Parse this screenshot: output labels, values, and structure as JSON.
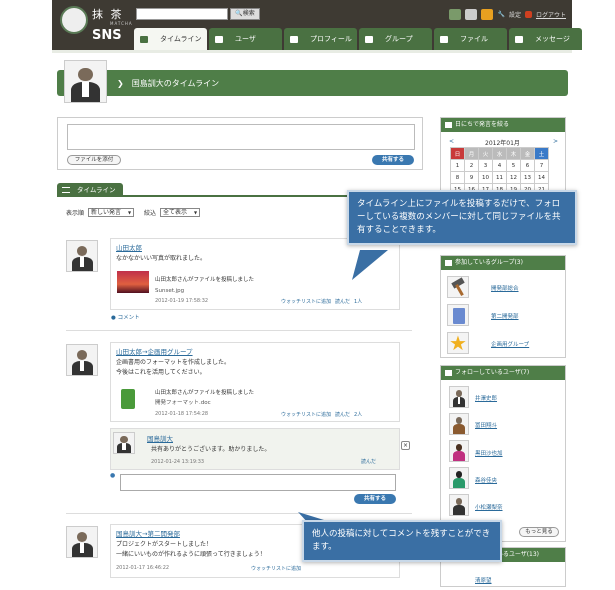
{
  "logo": {
    "top": "抹 茶",
    "sub": "MATCHA",
    "main": "SNS"
  },
  "header": {
    "search_btn": "検索",
    "settings": "設定",
    "logout": "ログアウト"
  },
  "tabs": [
    {
      "label": "タイムライン"
    },
    {
      "label": "ユーザ"
    },
    {
      "label": "プロフィール"
    },
    {
      "label": "グループ"
    },
    {
      "label": "ファイル"
    },
    {
      "label": "メッセージ"
    }
  ],
  "page_title": "国島訓大のタイムライン",
  "compose": {
    "file_btn": "ファイルを添付",
    "share_btn": "共有する"
  },
  "timeline_tab": "タイムライン",
  "filter": {
    "order_label": "表示順",
    "order_value": "新しい発言",
    "narrow_label": "絞込",
    "narrow_value": "全て表示"
  },
  "posts": [
    {
      "user": "山田太郎",
      "text": "なかなかいい写真が取れました。",
      "attach_title": "山田太郎さんがファイルを投稿しました",
      "attach_file": "Sunset.jpg",
      "time": "2012-01-19 17:58:32",
      "watch": "ウォッチリストに追加",
      "read": "読んだ",
      "read_count": "1人",
      "comment": "コメント"
    },
    {
      "user": "山田太郎→企画用グループ",
      "text1": "企画書用のフォーマットを作成しました。",
      "text2": "今後はこれを活用してください。",
      "attach_title": "山田太郎さんがファイルを投稿しました",
      "attach_file": "開発フォーマット.doc",
      "time": "2012-01-18 17:54:28",
      "watch": "ウォッチリストに追加",
      "read": "読んだ",
      "read_count": "2人"
    },
    {
      "user": "国島訓大→第二開発部",
      "text1": "プロジェクトがスタートしました！",
      "text2": "一緒にいいものが作れるように頑張って行きましょう！",
      "time": "2012-01-17 16:46:22",
      "watch": "ウォッチリストに追加"
    }
  ],
  "comment": {
    "user": "国島訓大",
    "text": "共有ありがとうございます。助かりました。",
    "time": "2012-01-24 13:19:33",
    "read": "読んだ",
    "share_btn": "共有する"
  },
  "calendar": {
    "title": "日にちで発言を絞る",
    "month": "2012年01月",
    "prev": "<",
    "next": ">",
    "days": [
      "日",
      "月",
      "火",
      "水",
      "木",
      "金",
      "土"
    ],
    "rows": [
      [
        "1",
        "2",
        "3",
        "4",
        "5",
        "6",
        "7"
      ],
      [
        "8",
        "9",
        "10",
        "11",
        "12",
        "13",
        "14"
      ],
      [
        "15",
        "16",
        "17",
        "18",
        "19",
        "20",
        "21"
      ]
    ]
  },
  "groups": {
    "title": "参加しているグループ(3)",
    "items": [
      "開発部総合",
      "第二開発部",
      "企画用グループ"
    ]
  },
  "following": {
    "title": "フォローしているユーザ(7)",
    "items": [
      "井澤史郎",
      "冨田翔斗",
      "黒田沙也加",
      "森谷佳央",
      "小松瀬梨奈"
    ],
    "more": "もっと見る"
  },
  "followers": {
    "title": "フォローされているユーザ(13)",
    "first": "清原望"
  },
  "callouts": {
    "top": "タイムライン上にファイルを投稿するだけで、フォローしている複数のメンバーに対して同じファイルを共有することできます。",
    "bottom": "他人の投稿に対してコメントを残すことができます。"
  }
}
